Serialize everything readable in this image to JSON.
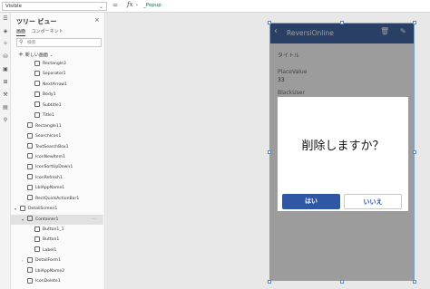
{
  "formula_bar": {
    "property": "Visible",
    "equals": "=",
    "fx": "fx",
    "formula": "_Popup"
  },
  "rail_icons": [
    "hamburger-icon",
    "layers-icon",
    "plus-icon",
    "data-icon",
    "media-icon",
    "variables-icon",
    "tools-icon",
    "settings-icon",
    "search-icon"
  ],
  "tree_panel": {
    "title": "ツリー ビュー",
    "close": "×",
    "tabs": [
      {
        "label": "画面",
        "active": true
      },
      {
        "label": "コンポーネント",
        "active": false
      }
    ],
    "search_placeholder": "検索",
    "new_screen_label": "新しい画面",
    "items": [
      {
        "label": "Rectangle3",
        "indent": 2
      },
      {
        "label": "Separator1",
        "indent": 2
      },
      {
        "label": "NextArrow1",
        "indent": 2
      },
      {
        "label": "Body1",
        "indent": 2
      },
      {
        "label": "Subtitle1",
        "indent": 2
      },
      {
        "label": "Title1",
        "indent": 2
      },
      {
        "label": "Rectangle11",
        "indent": 1
      },
      {
        "label": "SearchIcon1",
        "indent": 1
      },
      {
        "label": "TextSearchBox1",
        "indent": 1
      },
      {
        "label": "IconNewItem1",
        "indent": 1
      },
      {
        "label": "IconSortUpDown1",
        "indent": 1
      },
      {
        "label": "IconRefresh1",
        "indent": 1
      },
      {
        "label": "LblAppName1",
        "indent": 1
      },
      {
        "label": "RectQuickActionBar1",
        "indent": 1
      },
      {
        "label": "DetailScreen1",
        "indent": 0,
        "expand": "down"
      },
      {
        "label": "Container1",
        "indent": 1,
        "expand": "down",
        "selected": true,
        "more": "···"
      },
      {
        "label": "Button1_1",
        "indent": 2
      },
      {
        "label": "Button1",
        "indent": 2
      },
      {
        "label": "Label1",
        "indent": 2
      },
      {
        "label": "DetailForm1",
        "indent": 1,
        "expand": "right"
      },
      {
        "label": "LblAppName2",
        "indent": 1
      },
      {
        "label": "IconDelete1",
        "indent": 1
      }
    ]
  },
  "app": {
    "header_title": "ReversiOnline",
    "fields": [
      {
        "label": "タイトル",
        "value": ""
      },
      {
        "label": "PlaceValue",
        "value": "33"
      },
      {
        "label": "BlackUser",
        "value": ""
      }
    ],
    "dialog": {
      "message": "削除しますか？",
      "yes_label": "はい",
      "no_label": "いいえ"
    }
  },
  "colors": {
    "header_blue": "#3a5fa0",
    "button_blue": "#2f57a4",
    "formula_green": "#0a6e4e"
  }
}
